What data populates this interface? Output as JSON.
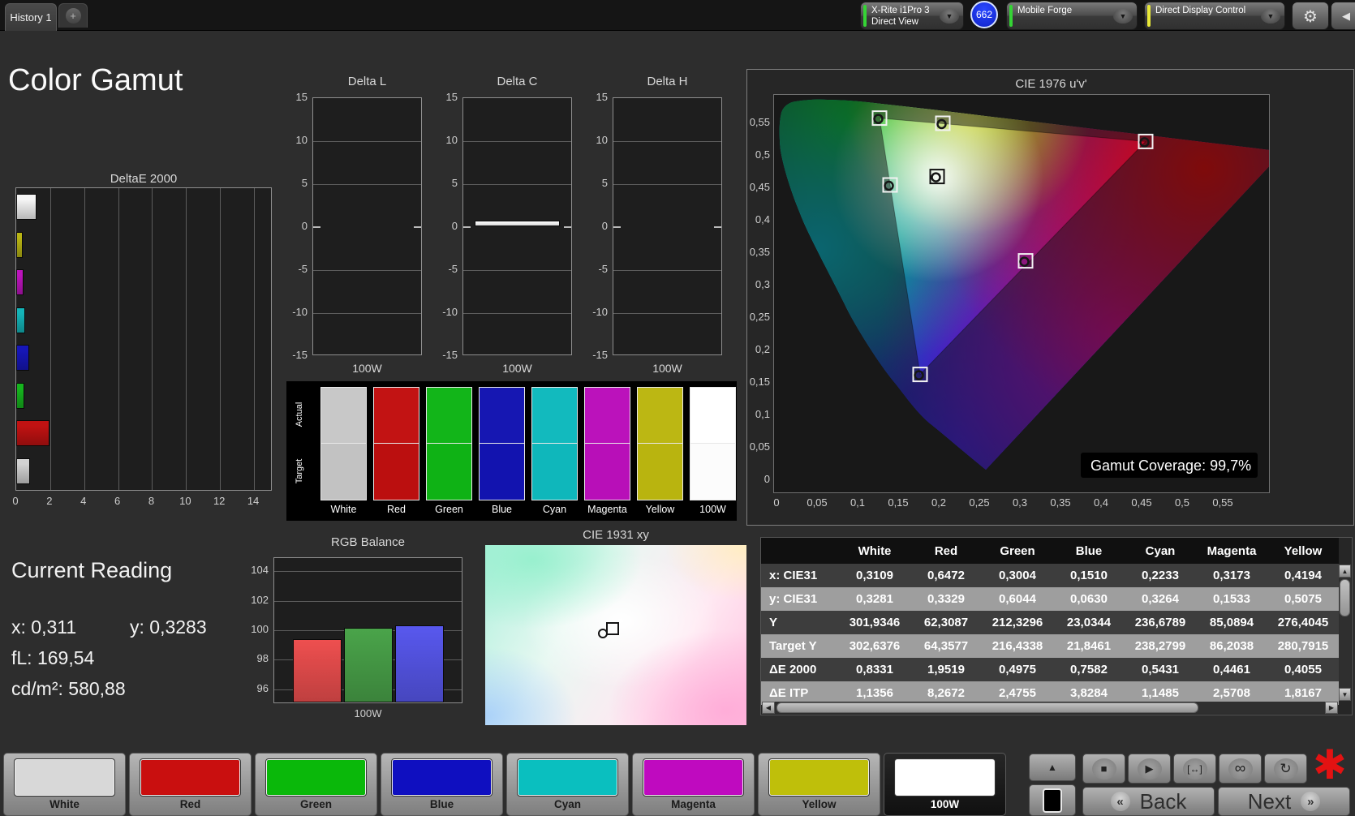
{
  "top_bar": {
    "tab": "History 1",
    "add_tab": "+",
    "meter": {
      "line1": "X-Rite i1Pro 3",
      "line2": "Direct View",
      "stripe_color": "#35d435"
    },
    "badge": "662",
    "workflow": {
      "label": "Mobile Forge",
      "stripe_color": "#35d435"
    },
    "device": {
      "label": "Direct Display Control",
      "stripe_color": "#e8e838"
    }
  },
  "page_title": "Color Gamut",
  "chart_data": [
    {
      "id": "deltae2000",
      "type": "bar",
      "orientation": "horizontal",
      "title": "DeltaE 2000",
      "categories": [
        "100W",
        "Yellow",
        "Magenta",
        "Cyan",
        "Blue",
        "Green",
        "Red",
        "White"
      ],
      "values": [
        1.2,
        0.4055,
        0.4461,
        0.5431,
        0.7582,
        0.4975,
        1.9519,
        0.8331
      ],
      "bar_colors": [
        "#f5f5f5",
        "#b8b414",
        "#bc14bc",
        "#14b4b8",
        "#1616b8",
        "#16b41e",
        "#c01212",
        "#d2d2d2"
      ],
      "xlim": [
        0,
        15
      ],
      "x_ticks": [
        "0",
        "2",
        "4",
        "6",
        "8",
        "10",
        "12",
        "14"
      ],
      "grid": true
    },
    {
      "id": "delta_l",
      "type": "bar",
      "title": "Delta L",
      "categories": [
        "100W"
      ],
      "values": [
        0
      ],
      "ylim": [
        -15,
        15
      ],
      "y_ticks": [
        "15",
        "10",
        "5",
        "0",
        "-5",
        "-10",
        "-15"
      ],
      "xlabel": "100W"
    },
    {
      "id": "delta_c",
      "type": "bar",
      "title": "Delta C",
      "categories": [
        "100W"
      ],
      "values": [
        0.7
      ],
      "ylim": [
        -15,
        15
      ],
      "y_ticks": [
        "15",
        "10",
        "5",
        "0",
        "-5",
        "-10",
        "-15"
      ],
      "xlabel": "100W",
      "bar_color": "#f8f8f8"
    },
    {
      "id": "delta_h",
      "type": "bar",
      "title": "Delta H",
      "categories": [
        "100W"
      ],
      "values": [
        0
      ],
      "ylim": [
        -15,
        15
      ],
      "y_ticks": [
        "15",
        "10",
        "5",
        "0",
        "-5",
        "-10",
        "-15"
      ],
      "xlabel": "100W"
    },
    {
      "id": "rgb_balance",
      "type": "bar",
      "title": "RGB Balance",
      "categories": [
        "Red",
        "Green",
        "Blue"
      ],
      "values": [
        99.4,
        100.15,
        100.35
      ],
      "bar_colors": [
        "#ee4f4f",
        "#4aa44a",
        "#5858ee"
      ],
      "ylim": [
        95.1,
        104.9
      ],
      "y_ticks": [
        "104",
        "102",
        "100",
        "98",
        "96"
      ],
      "xlabel": "100W",
      "grid": true
    },
    {
      "id": "cie1976",
      "type": "scatter",
      "title": "CIE 1976 u'v'",
      "xlim": [
        0,
        0.61
      ],
      "ylim": [
        0,
        0.6
      ],
      "x_ticks": [
        "0",
        "0,05",
        "0,1",
        "0,15",
        "0,2",
        "0,25",
        "0,3",
        "0,35",
        "0,4",
        "0,45",
        "0,5",
        "0,55"
      ],
      "y_ticks": [
        "0,55",
        "0,5",
        "0,45",
        "0,4",
        "0,35",
        "0,3",
        "0,25",
        "0,2",
        "0,15",
        "0,1",
        "0,05",
        "0"
      ],
      "points": [
        {
          "name": "green",
          "u": 0.126,
          "v": 0.558,
          "frame_dark": false
        },
        {
          "name": "yellow",
          "u": 0.204,
          "v": 0.55,
          "frame_dark": false
        },
        {
          "name": "red",
          "u": 0.454,
          "v": 0.522,
          "frame_dark": false
        },
        {
          "name": "cyan",
          "u": 0.139,
          "v": 0.455,
          "frame_dark": false
        },
        {
          "name": "white",
          "u": 0.197,
          "v": 0.468,
          "frame_dark": true
        },
        {
          "name": "magenta",
          "u": 0.306,
          "v": 0.338,
          "frame_dark": false
        },
        {
          "name": "blue",
          "u": 0.176,
          "v": 0.163,
          "frame_dark": false
        }
      ],
      "gamut_triangle": [
        "green",
        "red",
        "blue"
      ],
      "coverage_label": "Gamut Coverage:",
      "coverage_value": "99,7%"
    },
    {
      "id": "cie1931",
      "type": "scatter",
      "title": "CIE 1931 xy",
      "points": [
        {
          "name": "white",
          "x": 0.311,
          "y": 0.3283
        }
      ]
    }
  ],
  "swatch_strip": {
    "row_labels": [
      "Actual",
      "Target"
    ],
    "columns": [
      {
        "label": "White",
        "actual": "#c8c8c8",
        "target": "#c2c2c2"
      },
      {
        "label": "Red",
        "actual": "#c21313",
        "target": "#bb0f0f"
      },
      {
        "label": "Green",
        "actual": "#12b519",
        "target": "#0fb215"
      },
      {
        "label": "Blue",
        "actual": "#1617b2",
        "target": "#1213af"
      },
      {
        "label": "Cyan",
        "actual": "#12babe",
        "target": "#0fb7bb"
      },
      {
        "label": "Magenta",
        "actual": "#bb12bb",
        "target": "#b80fb8"
      },
      {
        "label": "Yellow",
        "actual": "#bcb713",
        "target": "#b9b40f"
      },
      {
        "label": "100W",
        "actual": "#ffffff",
        "target": "#fcfcfc"
      }
    ]
  },
  "current_reading": {
    "title": "Current Reading",
    "x": "x: 0,311",
    "y": "y: 0,3283",
    "fl": "fL: 169,54",
    "cd": "cd/m²: 580,88"
  },
  "table": {
    "headers": [
      "",
      "White",
      "Red",
      "Green",
      "Blue",
      "Cyan",
      "Magenta",
      "Yellow"
    ],
    "rows": [
      {
        "label": "x: CIE31",
        "values": [
          "0,3109",
          "0,6472",
          "0,3004",
          "0,1510",
          "0,2233",
          "0,3173",
          "0,4194"
        ]
      },
      {
        "label": "y: CIE31",
        "values": [
          "0,3281",
          "0,3329",
          "0,6044",
          "0,0630",
          "0,3264",
          "0,1533",
          "0,5075"
        ]
      },
      {
        "label": "Y",
        "values": [
          "301,9346",
          "62,3087",
          "212,3296",
          "23,0344",
          "236,6789",
          "85,0894",
          "276,4045"
        ]
      },
      {
        "label": "Target Y",
        "values": [
          "302,6376",
          "64,3577",
          "216,4338",
          "21,8461",
          "238,2799",
          "86,2038",
          "280,7915"
        ]
      },
      {
        "label": "ΔE 2000",
        "values": [
          "0,8331",
          "1,9519",
          "0,4975",
          "0,7582",
          "0,5431",
          "0,4461",
          "0,4055"
        ]
      },
      {
        "label": "ΔE ITP",
        "values": [
          "1,1356",
          "8,2672",
          "2,4755",
          "3,8284",
          "1,1485",
          "2,5708",
          "1,8167"
        ],
        "partial": true
      }
    ]
  },
  "bottom_bar": {
    "patches": [
      {
        "label": "White",
        "color": "#d8d8d8",
        "selected": false
      },
      {
        "label": "Red",
        "color": "#c90f0f",
        "selected": false
      },
      {
        "label": "Green",
        "color": "#0ab80a",
        "selected": false
      },
      {
        "label": "Blue",
        "color": "#0f0fc0",
        "selected": false
      },
      {
        "label": "Cyan",
        "color": "#0abfbf",
        "selected": false
      },
      {
        "label": "Magenta",
        "color": "#bf0abf",
        "selected": false
      },
      {
        "label": "Yellow",
        "color": "#bfbf0a",
        "selected": false
      },
      {
        "label": "100W",
        "color": "#ffffff",
        "selected": true
      }
    ],
    "transport": [
      {
        "name": "stop",
        "glyph": "■"
      },
      {
        "name": "play",
        "glyph": "▶"
      },
      {
        "name": "range",
        "glyph": "[↔]"
      },
      {
        "name": "loop",
        "glyph": "∞"
      },
      {
        "name": "refresh",
        "glyph": "↻"
      }
    ],
    "back": "Back",
    "next": "Next",
    "back_glyph": "«",
    "next_glyph": "»",
    "up_glyph": "▲"
  }
}
